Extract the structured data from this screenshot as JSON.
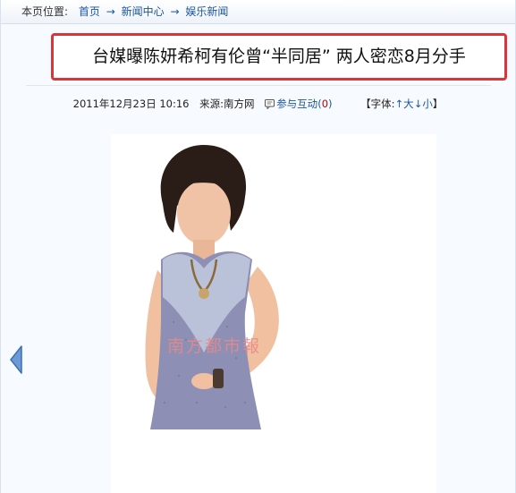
{
  "breadcrumb": {
    "lead": "本页位置:",
    "items": [
      "首页",
      "新闻中心",
      "娱乐新闻"
    ],
    "separator": "→"
  },
  "article": {
    "title": "台媒曝陈妍希柯有伦曾“半同居” 两人密恋8月分手",
    "datetime": "2011年12月23日 10:16",
    "source_label": "来源:",
    "source": "南方网",
    "comment_label": "参与互动",
    "comment_open": "(",
    "comment_count": "0",
    "comment_close": ")",
    "font_label": "【字体:",
    "font_bigger": "↑大",
    "font_smaller": "↓小",
    "font_close": "】"
  },
  "photo": {
    "watermark": "南方都市報"
  },
  "icons": {
    "prev": "left-triangle-arrow-icon",
    "comment": "comment-icon"
  },
  "colors": {
    "title_border": "#d8363a",
    "link": "#1a55a6",
    "count": "#c00000"
  }
}
